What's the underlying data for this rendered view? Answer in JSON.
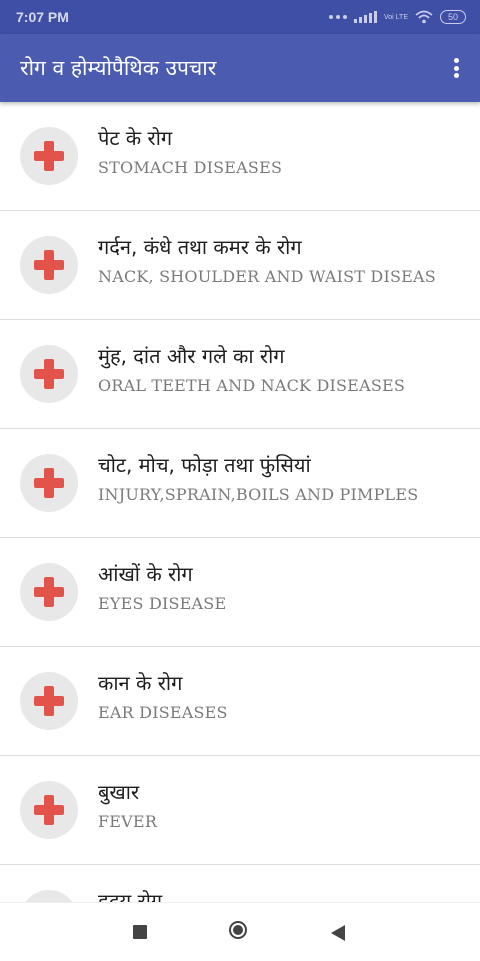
{
  "status": {
    "time": "7:07 PM",
    "lte_label": "Voi LTE",
    "battery": "50"
  },
  "app": {
    "title": "रोग व होम्योपैथिक उपचार",
    "menu_icon": "more-vert-icon"
  },
  "items": [
    {
      "title": "पेट के रोग",
      "subtitle": "STOMACH DISEASES",
      "icon": "medical-cross-icon"
    },
    {
      "title": "गर्दन, कंधे तथा कमर के रोग",
      "subtitle": "NACK, SHOULDER AND WAIST DISEAS",
      "icon": "medical-cross-icon"
    },
    {
      "title": "मुंह, दांत और गले का रोग",
      "subtitle": "ORAL TEETH AND NACK DISEASES",
      "icon": "medical-cross-icon"
    },
    {
      "title": "चोट, मोच, फोड़ा तथा फुंसियां",
      "subtitle": "INJURY,SPRAIN,BOILS AND PIMPLES",
      "icon": "medical-cross-icon"
    },
    {
      "title": "आंखों के रोग",
      "subtitle": "EYES DISEASE",
      "icon": "medical-cross-icon"
    },
    {
      "title": "कान के रोग",
      "subtitle": "EAR DISEASES",
      "icon": "medical-cross-icon"
    },
    {
      "title": "बुखार",
      "subtitle": "FEVER",
      "icon": "medical-cross-icon"
    },
    {
      "title": "हृदय रोग",
      "subtitle": "",
      "icon": "medical-cross-icon"
    }
  ],
  "colors": {
    "status_bar": "#3f4fa6",
    "app_bar": "#4b5cb0",
    "cross": "#e2544b",
    "icon_bg": "#e8e8e8"
  }
}
